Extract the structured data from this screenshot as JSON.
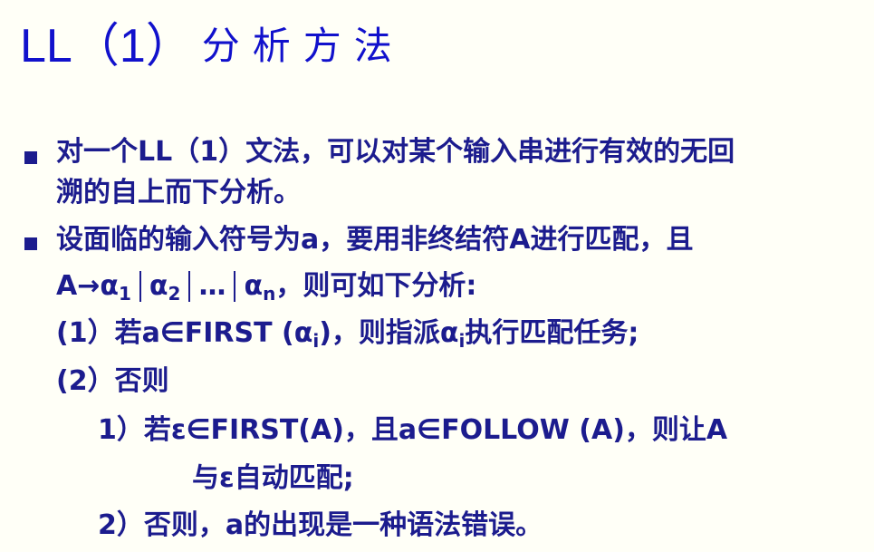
{
  "title": {
    "latin": "LL（1）",
    "cjk": "分析方法"
  },
  "lines": [
    "对一个LL（1）文法，可以对某个输入串进行有效的无回",
    "溯的自上而下分析。",
    "设面临的输入符号为a，要用非终结符A进行匹配，且"
  ],
  "production": {
    "lhs": "A→",
    "alpha": "α",
    "sub1": "1",
    "sub2": "2",
    "ellipsis": "…",
    "subn": "n",
    "tail": "，则可如下分析:"
  },
  "case1": {
    "pre": "(1）若a∈FIRST (",
    "alpha": "α",
    "sub": "i",
    "mid": ")，则指派",
    "alpha2": "α",
    "sub2": "i",
    "post": "执行匹配任务;"
  },
  "case2": "(2）否则",
  "sub_case1_line1": "1）若ε∈FIRST(A)，且a∈FOLLOW (A)，则让A",
  "sub_case1_line2": "与ε自动匹配;",
  "sub_case2": "2）否则，a的出现是一种语法错误。",
  "colors": {
    "title": "#1111cc",
    "body_text": "#1c1c8e",
    "background": "#fffff7"
  },
  "icons": [
    "square-bullet-icon",
    "square-bullet-icon"
  ]
}
